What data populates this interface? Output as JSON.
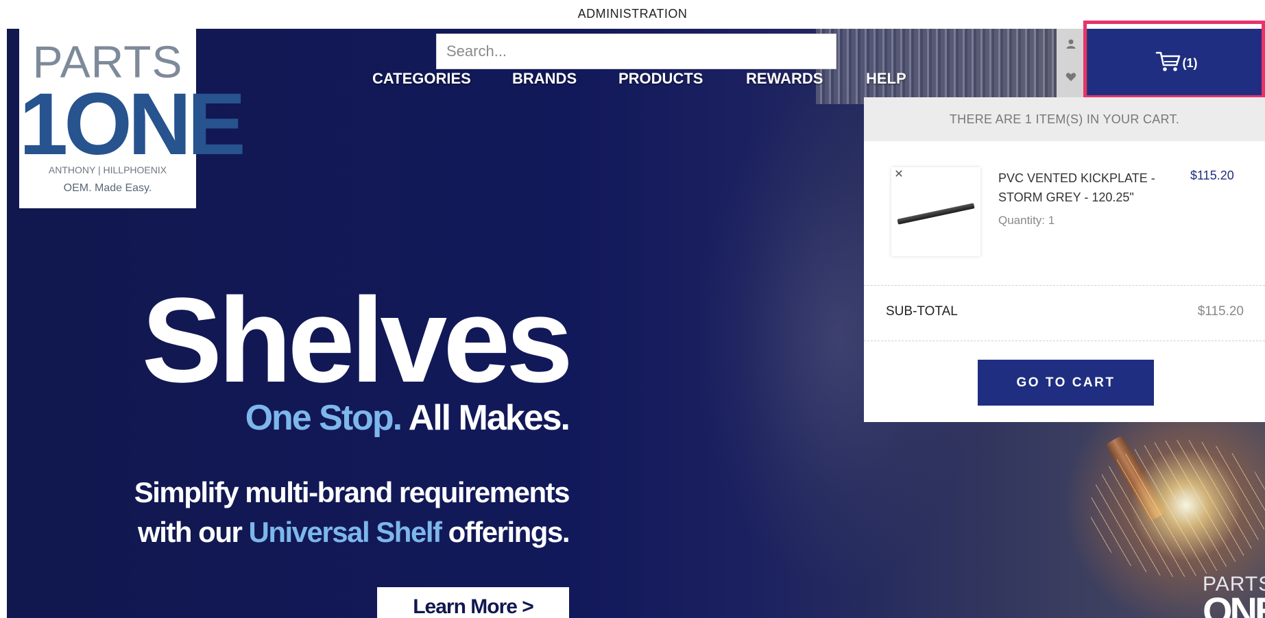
{
  "topbar": {
    "admin_label": "ADMINISTRATION"
  },
  "brand": {
    "logo_parts": "PARTS",
    "logo_one": "1ONE",
    "logo_subtitle": "ANTHONY | HILLPHOENIX",
    "logo_tagline": "OEM. Made Easy."
  },
  "search": {
    "placeholder": "Search..."
  },
  "nav": {
    "items": [
      {
        "label": "CATEGORIES"
      },
      {
        "label": "BRANDS"
      },
      {
        "label": "PRODUCTS"
      },
      {
        "label": "REWARDS"
      },
      {
        "label": "HELP"
      }
    ]
  },
  "utility": {
    "account_icon": "user-icon",
    "wishlist_icon": "heart-icon"
  },
  "cart": {
    "icon": "cart-icon",
    "count_label": "(1)",
    "dropdown": {
      "header": "THERE ARE 1 ITEM(S) IN YOUR CART.",
      "items": [
        {
          "name": "PVC VENTED KICKPLATE - STORM GREY - 120.25\"",
          "quantity": "Quantity: 1",
          "price": "$115.20",
          "remove_icon": "close-icon"
        }
      ],
      "subtotal_label": "SUB-TOTAL",
      "subtotal_value": "$115.20",
      "go_to_cart_label": "GO TO CART"
    }
  },
  "hero": {
    "title": "Shelves",
    "sub_accent": "One Stop.",
    "sub_rest": " All Makes.",
    "copy_line1": "Simplify multi-brand requirements",
    "copy_line2_pre": "with our ",
    "copy_line2_accent": "Universal Shelf",
    "copy_line2_post": " offerings.",
    "cta_label": "Learn More >",
    "corner_logo_parts": "PARTS",
    "corner_logo_one": "ONE"
  },
  "colors": {
    "brand_navy": "#1f2e80",
    "hero_bg": "#11184f",
    "accent_blue": "#7db7ec",
    "highlight_pink": "#e8336b"
  }
}
